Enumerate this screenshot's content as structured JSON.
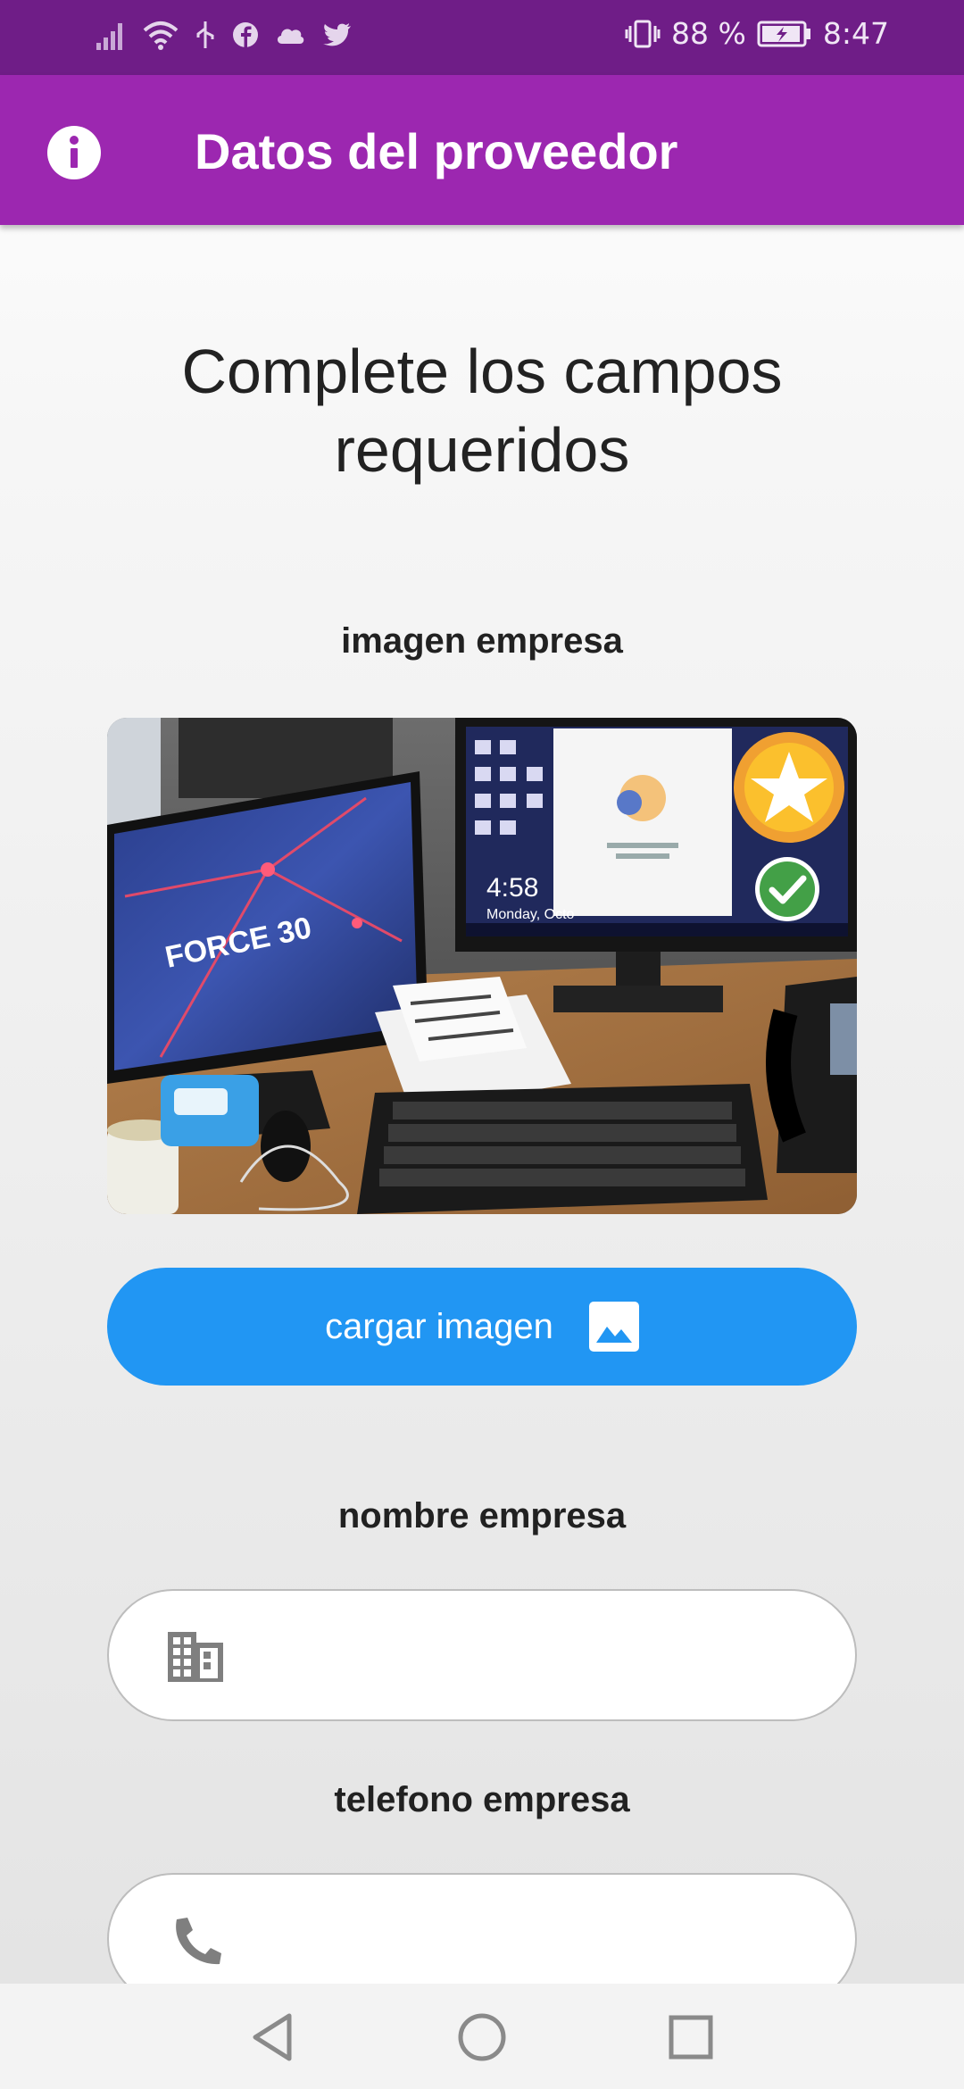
{
  "status_bar": {
    "battery": "88 %",
    "time": "8:47"
  },
  "app_bar": {
    "title": "Datos del proveedor",
    "icon": "info-icon"
  },
  "form": {
    "heading_line1": "Complete los campos",
    "heading_line2": "requeridos",
    "image_label": "imagen empresa",
    "upload_button_label": "cargar imagen",
    "upload_button_icon": "image-icon",
    "name_label": "nombre empresa",
    "name_value": "",
    "name_icon": "building-icon",
    "phone_label": "telefono empresa",
    "phone_value": "",
    "phone_icon": "phone-icon"
  },
  "photo": {
    "monitor_text": "FORCE 30",
    "screen_time": "4:58",
    "screen_date": "Monday, Octo"
  },
  "colors": {
    "status_bar": "#6f1d87",
    "app_bar": "#9c27b0",
    "button": "#2196f3"
  },
  "nav_bar": {
    "icons": [
      "back-icon",
      "home-icon",
      "recents-icon"
    ]
  }
}
